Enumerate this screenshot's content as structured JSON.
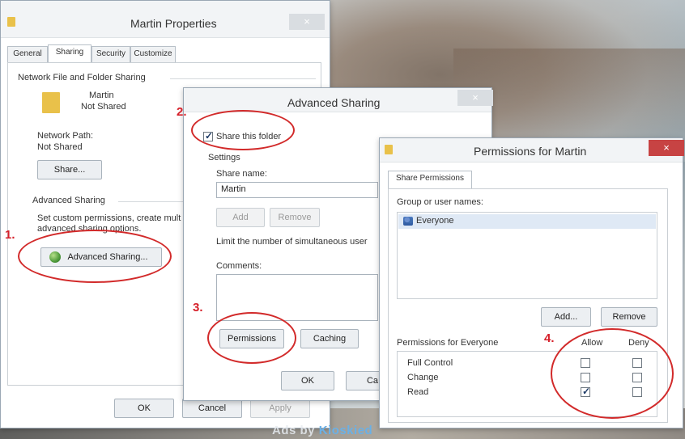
{
  "watermark": {
    "prefix": "Ads by",
    "brand": "Kioskied"
  },
  "annotations": {
    "step1": "1.",
    "step2": "2.",
    "step3": "3.",
    "step4": "4."
  },
  "properties": {
    "title": "Martin Properties",
    "close": "×",
    "tabs": [
      "General",
      "Sharing",
      "Security",
      "Customize"
    ],
    "net_group": "Network File and Folder Sharing",
    "folder_name": "Martin",
    "folder_status": "Not Shared",
    "net_path_label": "Network Path:",
    "net_path_value": "Not Shared",
    "share_button": "Share...",
    "adv_group": "Advanced Sharing",
    "adv_desc_1": "Set custom permissions, create mult",
    "adv_desc_2": "advanced sharing options.",
    "adv_button": "Advanced Sharing...",
    "ok": "OK",
    "cancel": "Cancel",
    "apply": "Apply"
  },
  "advanced": {
    "title": "Advanced Sharing",
    "close": "×",
    "share_checkbox": "Share this folder",
    "settings_label": "Settings",
    "share_name_label": "Share name:",
    "share_name_value": "Martin",
    "add": "Add",
    "remove": "Remove",
    "limit_label": "Limit the number of simultaneous user",
    "comments_label": "Comments:",
    "permissions_button": "Permissions",
    "caching_button": "Caching",
    "ok": "OK",
    "cancel_partial": "Ca"
  },
  "permissions": {
    "title": "Permissions for Martin",
    "close": "×",
    "tab": "Share Permissions",
    "group_label": "Group or user names:",
    "users": [
      "Everyone"
    ],
    "add": "Add...",
    "remove": "Remove",
    "perm_label": "Permissions for Everyone",
    "allow": "Allow",
    "deny": "Deny",
    "rows": [
      {
        "name": "Full Control",
        "allow": false,
        "deny": false
      },
      {
        "name": "Change",
        "allow": false,
        "deny": false
      },
      {
        "name": "Read",
        "allow": true,
        "deny": false
      }
    ]
  }
}
